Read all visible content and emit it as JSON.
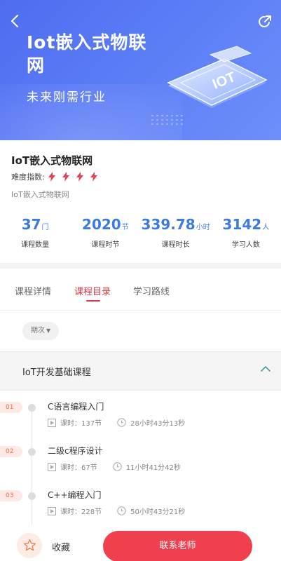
{
  "banner": {
    "title": "Iot嵌入式物联网",
    "subtitle": "未来刚需行业",
    "chip_text": "IOT",
    "back_icon": "chevron-left-icon",
    "share_icon": "share-icon",
    "gradient_start": "#4f6cf0",
    "gradient_end": "#6d8ff9"
  },
  "course": {
    "title": "IoT嵌入式物联网",
    "difficulty_label": "难度指数:",
    "difficulty_level": 4,
    "subtitle": "IoT嵌入式物联网",
    "accent_color": "#d63b4a"
  },
  "stats": [
    {
      "value": "37",
      "unit": "门",
      "label": "课程数量"
    },
    {
      "value": "2020",
      "unit": "节",
      "label": "课程时节"
    },
    {
      "value": "339.78",
      "unit": "小时",
      "label": "课程时长"
    },
    {
      "value": "3142",
      "unit": "人",
      "label": "学习人数"
    }
  ],
  "tabs": [
    {
      "label": "课程详情",
      "active": false
    },
    {
      "label": "课程目录",
      "active": true
    },
    {
      "label": "学习路线",
      "active": false
    }
  ],
  "filter": {
    "label": "期次",
    "caret": "▼"
  },
  "section": {
    "title": "IoT开发基础课程",
    "expanded": true
  },
  "lessons": [
    {
      "index": "01",
      "title": "C语言编程入门",
      "lessons_text": "课时：137节",
      "duration": "28小时43分13秒"
    },
    {
      "index": "02",
      "title": "二级c程序设计",
      "lessons_text": "课时：67节",
      "duration": "11小时41分42秒"
    },
    {
      "index": "03",
      "title": "C++编程入门",
      "lessons_text": "课时：228节",
      "duration": "50小时43分21秒"
    }
  ],
  "bottom": {
    "favorite_label": "收藏",
    "favorite_icon": "star-icon",
    "contact_label": "联系老师",
    "contact_color": "#f0404e"
  }
}
